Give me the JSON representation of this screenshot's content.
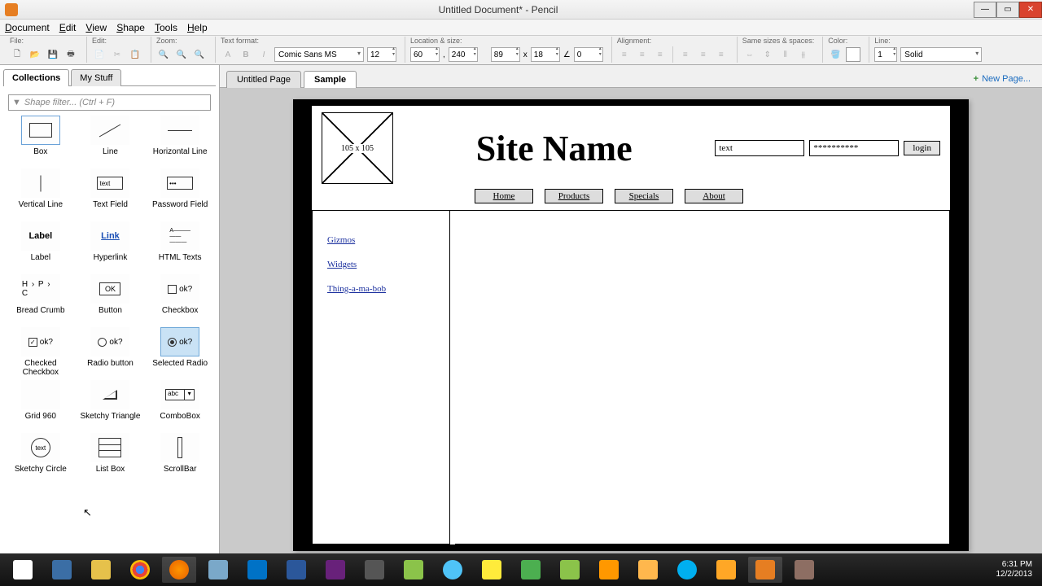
{
  "window": {
    "title": "Untitled Document* - Pencil"
  },
  "menu": {
    "document": "Document",
    "edit": "Edit",
    "view": "View",
    "shape": "Shape",
    "tools": "Tools",
    "help": "Help"
  },
  "toolbar": {
    "groups": {
      "file": "File:",
      "edit": "Edit:",
      "zoom": "Zoom:",
      "textformat": "Text format:",
      "location": "Location & size:",
      "alignment": "Alignment:",
      "samesizes": "Same sizes & spaces:",
      "color": "Color:",
      "line": "Line:"
    },
    "font": "Comic Sans MS",
    "fontsize": "12",
    "loc_x": "60",
    "loc_y": "240",
    "size_w": "89",
    "size_h": "18",
    "rot": "0",
    "line_w": "1",
    "line_style": "Solid"
  },
  "sidebar": {
    "tabs": {
      "collections": "Collections",
      "mystuff": "My Stuff"
    },
    "filter_placeholder": "Shape filter... (Ctrl + F)",
    "shapes": [
      {
        "label": "Box"
      },
      {
        "label": "Line"
      },
      {
        "label": "Horizontal Line"
      },
      {
        "label": "Vertical Line"
      },
      {
        "label": "Text Field",
        "preview": "text"
      },
      {
        "label": "Password Field",
        "preview": "•••"
      },
      {
        "label": "Label",
        "preview": "Label"
      },
      {
        "label": "Hyperlink",
        "preview": "Link"
      },
      {
        "label": "HTML Texts"
      },
      {
        "label": "Bread Crumb",
        "preview": "H › P › C"
      },
      {
        "label": "Button",
        "preview": "OK"
      },
      {
        "label": "Checkbox",
        "preview": "ok?"
      },
      {
        "label": "Checked Checkbox",
        "preview": "ok?"
      },
      {
        "label": "Radio button",
        "preview": "ok?"
      },
      {
        "label": "Selected Radio",
        "preview": "ok?"
      },
      {
        "label": "Grid 960"
      },
      {
        "label": "Sketchy Triangle"
      },
      {
        "label": "ComboBox",
        "preview": "abc"
      },
      {
        "label": "Sketchy Circle",
        "preview": "text"
      },
      {
        "label": "List Box"
      },
      {
        "label": "ScrollBar"
      }
    ]
  },
  "pages": {
    "untitled": "Untitled Page",
    "sample": "Sample",
    "newpage": "New Page..."
  },
  "wireframe": {
    "imgbox": "105 x 105",
    "siteName": "Site Name",
    "login_text": "text",
    "login_pw": "**********",
    "login_btn": "login",
    "nav": [
      "Home",
      "Products",
      "Specials",
      "About"
    ],
    "sidelinks": [
      "Gizmos",
      "Widgets",
      "Thing-a-ma-bob"
    ]
  },
  "tray": {
    "time": "6:31 PM",
    "date": "12/2/2013"
  }
}
